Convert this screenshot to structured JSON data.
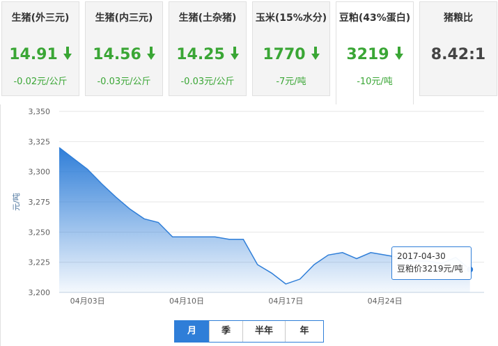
{
  "cards": [
    {
      "name": "生猪(外三元)",
      "price": "14.91",
      "change": "-0.02元/公斤",
      "trend": "down"
    },
    {
      "name": "生猪(内三元)",
      "price": "14.56",
      "change": "-0.03元/公斤",
      "trend": "down"
    },
    {
      "name": "生猪(土杂猪)",
      "price": "14.25",
      "change": "-0.03元/公斤",
      "trend": "down"
    },
    {
      "name": "玉米(15%水分)",
      "price": "1770",
      "change": "-7元/吨",
      "trend": "down"
    },
    {
      "name": "豆粕(43%蛋白)",
      "price": "3219",
      "change": "-10元/吨",
      "trend": "down"
    },
    {
      "name": "猪粮比",
      "ratio": "8.42:1"
    }
  ],
  "active_card_index": 4,
  "colors": {
    "up_down_green": "#3aa635",
    "accent_blue": "#2f7ed8"
  },
  "chart_data": {
    "type": "area",
    "ylabel": "元/吨",
    "ylim": [
      3200,
      3350
    ],
    "y_ticks": [
      "3,350",
      "3,325",
      "3,300",
      "3,275",
      "3,250",
      "3,225",
      "3,200"
    ],
    "y_tick_values": [
      3350,
      3325,
      3300,
      3275,
      3250,
      3225,
      3200
    ],
    "x_tick_labels": [
      "04月03日",
      "04月10日",
      "04月17日",
      "04月24日"
    ],
    "x_tick_days": [
      3,
      10,
      17,
      24
    ],
    "xlim_days": [
      1,
      31
    ],
    "grid": true,
    "series": [
      {
        "days": [
          1,
          2,
          3,
          4,
          5,
          6,
          7,
          8,
          9,
          10,
          11,
          12,
          13,
          14,
          15,
          16,
          17,
          18,
          19,
          20,
          21,
          22,
          23,
          24,
          25,
          26,
          27,
          28,
          29,
          30
        ],
        "values": [
          3320,
          3311,
          3302,
          3290,
          3279,
          3269,
          3261,
          3258,
          3246,
          3246,
          3246,
          3246,
          3244,
          3244,
          3223,
          3216,
          3207,
          3211,
          3223,
          3231,
          3233,
          3228,
          3233,
          3231,
          3229,
          3226,
          3226,
          3224,
          3229,
          3219
        ]
      }
    ],
    "tooltip": {
      "date": "2017-04-30",
      "text": "豆粕价3219元/吨"
    }
  },
  "range_tabs": [
    "月",
    "季",
    "半年",
    "年"
  ],
  "range_active": 0
}
